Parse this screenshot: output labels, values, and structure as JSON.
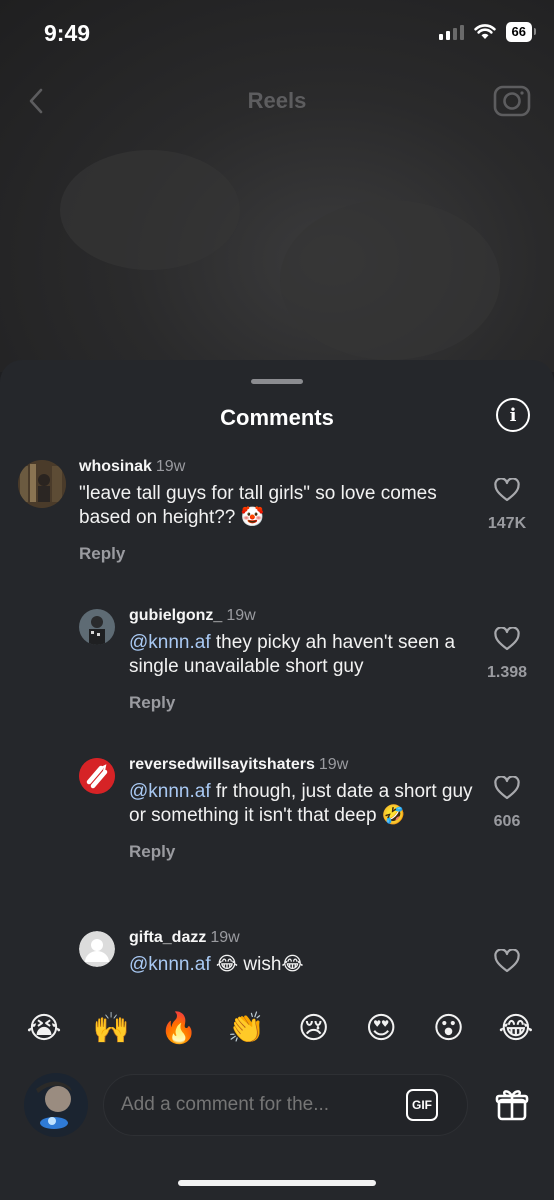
{
  "status": {
    "time": "9:49",
    "battery": "66"
  },
  "header": {
    "title": "Reels"
  },
  "sheet": {
    "title": "Comments"
  },
  "comments": [
    {
      "user": "whosinak",
      "time": "19w",
      "text": "\"leave tall guys for tall girls\" so love comes based on height?? 🤡",
      "reply": "Reply",
      "likes": "147K"
    },
    {
      "user": "gubielgonz_",
      "time": "19w",
      "mention": "@knnn.af",
      "text": " they picky ah haven't seen a single unavailable short guy",
      "reply": "Reply",
      "likes": "1.398"
    },
    {
      "user": "reversedwillsayitshaters",
      "time": "19w",
      "mention": "@knnn.af",
      "text": " fr though, just date a short guy or something it isn't that deep 🤣",
      "reply": "Reply",
      "likes": "606"
    },
    {
      "user": "gifta_dazz",
      "time": "19w",
      "mention": "@knnn.af",
      "text": " 😂 wish😂",
      "likes": ""
    }
  ],
  "emojis": [
    "😭",
    "🙌",
    "🔥",
    "👏",
    "😢",
    "😍",
    "😮",
    "😂"
  ],
  "composer": {
    "placeholder": "Add a comment for the...",
    "gif": "GIF"
  }
}
